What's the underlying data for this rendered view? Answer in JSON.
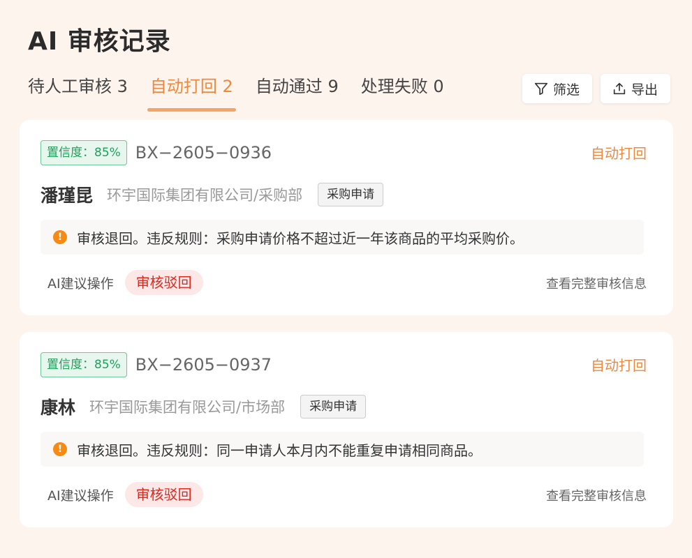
{
  "page": {
    "title": "AI 审核记录"
  },
  "tabs": [
    {
      "label": "待人工审核 3",
      "active": false
    },
    {
      "label": "自动打回 2",
      "active": true
    },
    {
      "label": "自动通过 9",
      "active": false
    },
    {
      "label": "处理失败 0",
      "active": false
    }
  ],
  "toolbar": {
    "filter_label": "筛选",
    "export_label": "导出",
    "filter_icon": "filter-icon",
    "export_icon": "upload-icon"
  },
  "colors": {
    "accent": "#f0883c",
    "confidence_green": "#239d5c",
    "reject_red": "#e0281c",
    "warning_orange": "#f58a14"
  },
  "records": [
    {
      "confidence": "置信度：85%",
      "id": "BX−2605−0936",
      "status": "自动打回",
      "name": "潘瑾昆",
      "org": "环宇国际集团有限公司/采购部",
      "type": "采购申请",
      "notice": "审核退回。违反规则：采购申请价格不超过近一年该商品的平均采购价。",
      "ai_label": "AI建议操作",
      "ai_action": "审核驳回",
      "details_link": "查看完整审核信息"
    },
    {
      "confidence": "置信度：85%",
      "id": "BX−2605−0937",
      "status": "自动打回",
      "name": "康林",
      "org": "环宇国际集团有限公司/市场部",
      "type": "采购申请",
      "notice": "审核退回。违反规则：同一申请人本月内不能重复申请相同商品。",
      "ai_label": "AI建议操作",
      "ai_action": "审核驳回",
      "details_link": "查看完整审核信息"
    }
  ]
}
